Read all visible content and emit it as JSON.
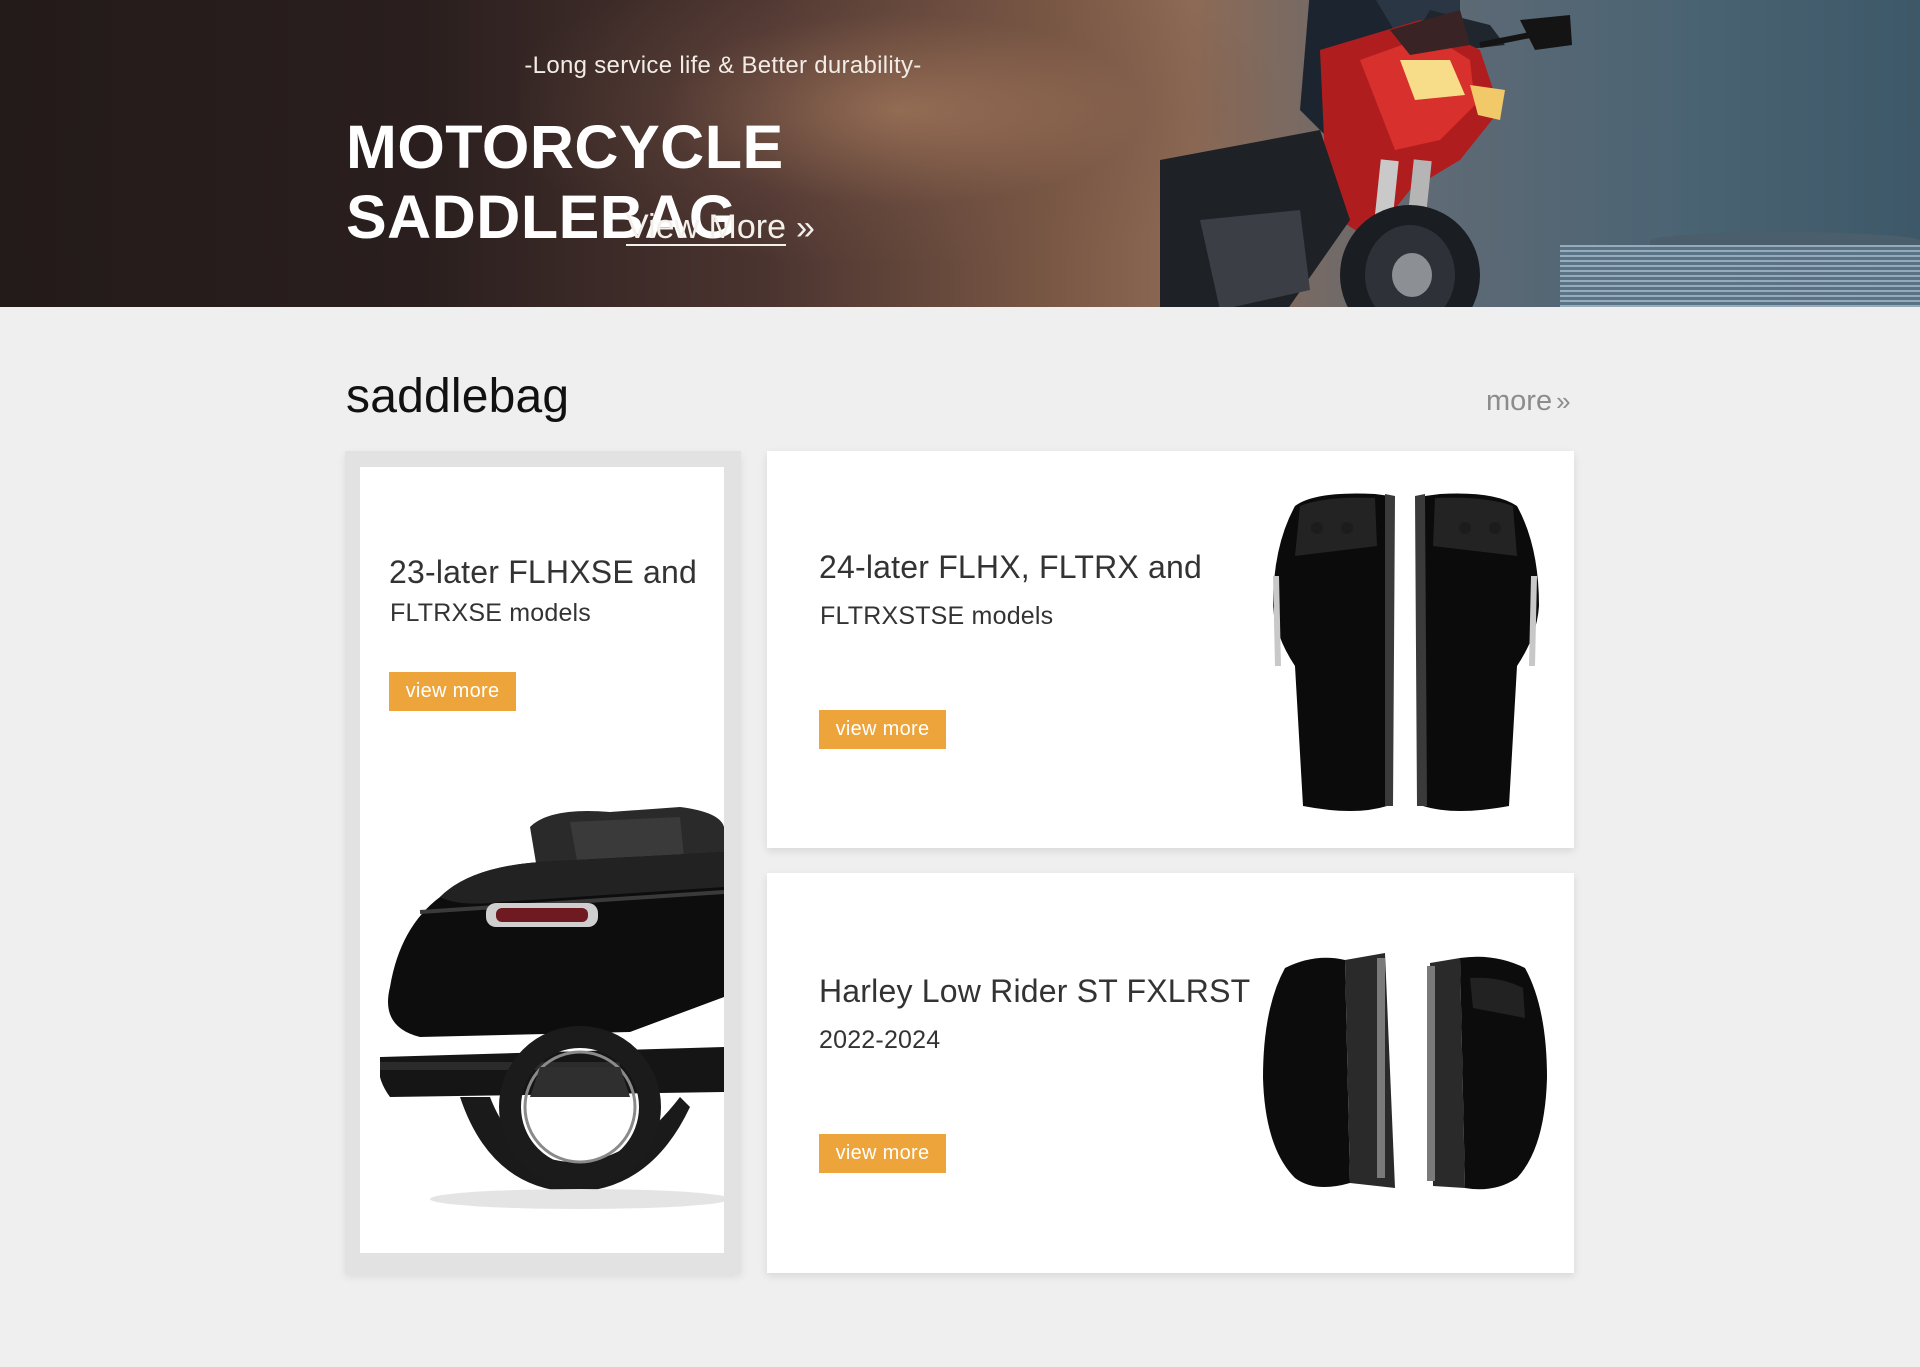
{
  "hero": {
    "subtitle": "-Long service life & Better durability-",
    "title": "MOTORCYCLE SADDLEBAG",
    "cta_label": "View More",
    "cta_icon": "double-chevron-right-icon"
  },
  "section": {
    "title": "saddlebag",
    "more_label": "more",
    "more_icon": "double-chevron-right-icon"
  },
  "cards": [
    {
      "title": "23-later FLHXSE and",
      "subtitle": "FLTRXSE models",
      "button_label": "view more",
      "image": "touring-bike-saddlebag-photo"
    },
    {
      "title": "24-later FLHX, FLTRX and",
      "subtitle": "FLTRXSTSE models",
      "button_label": "view more",
      "image": "saddlebag-pair-photo"
    },
    {
      "title": "Harley Low Rider ST FXLRST",
      "subtitle": "2022-2024",
      "button_label": "view more",
      "image": "saddlebag-pair-open-photo"
    }
  ],
  "colors": {
    "accent_button": "#eda43b",
    "page_background": "#efefef",
    "hero_dark": "#231a1a"
  }
}
